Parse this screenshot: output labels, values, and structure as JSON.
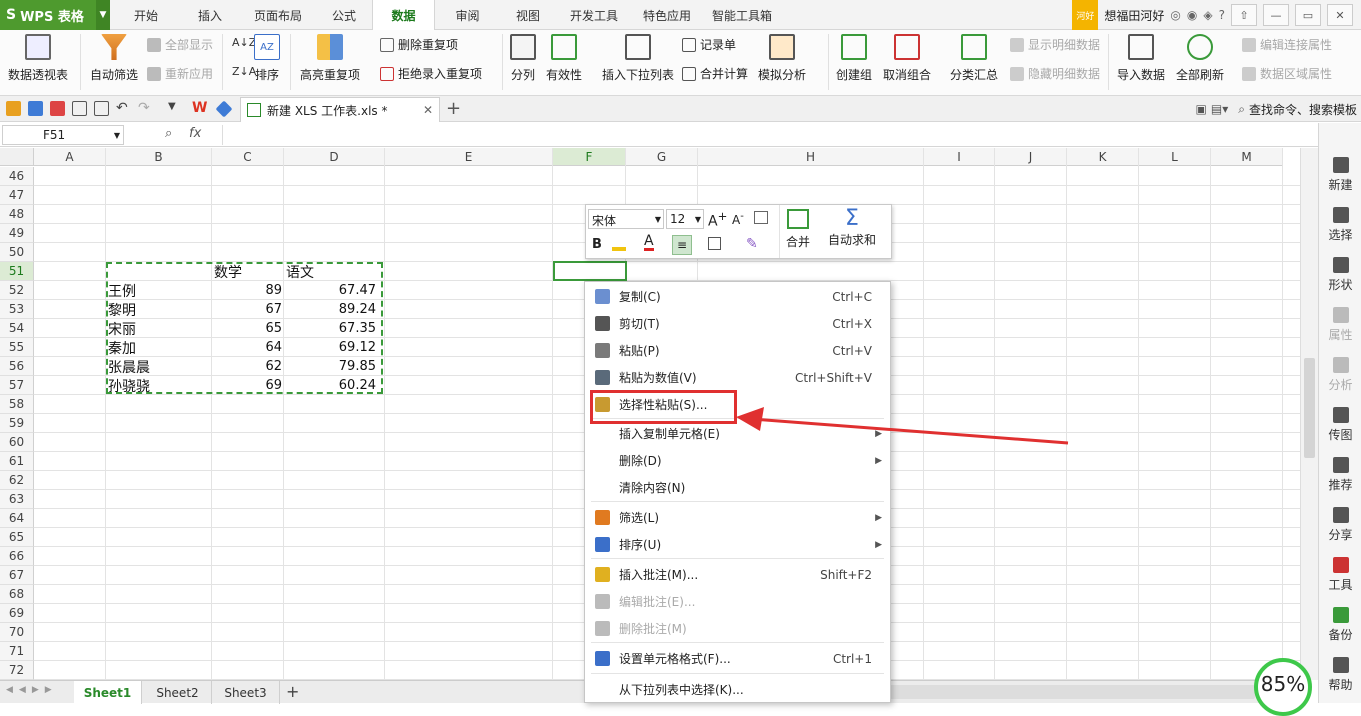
{
  "app": {
    "name": "WPS 表格"
  },
  "menu_tabs": [
    "开始",
    "插入",
    "页面布局",
    "公式",
    "数据",
    "审阅",
    "视图",
    "开发工具",
    "特色应用",
    "智能工具箱"
  ],
  "active_tab": "数据",
  "user": {
    "badge": "河好",
    "name": "想福田河好"
  },
  "ribbon": {
    "pivot": "数据透视表",
    "autofilter": "自动筛选",
    "show_all": "全部显示",
    "reapply": "重新应用",
    "sort": "排序",
    "highlight_dup": "高亮重复项",
    "remove_dup": "删除重复项",
    "reject_dup": "拒绝录入重复项",
    "split": "分列",
    "validity": "有效性",
    "insert_dropdown": "插入下拉列表",
    "record": "记录单",
    "consolidate": "合并计算",
    "whatif": "模拟分析",
    "group": "创建组",
    "ungroup": "取消组合",
    "subtotal": "分类汇总",
    "show_detail": "显示明细数据",
    "hide_detail": "隐藏明细数据",
    "import": "导入数据",
    "refresh_all": "全部刷新",
    "edit_links": "编辑连接属性",
    "range_props": "数据区域属性"
  },
  "doc_tab": {
    "title": "新建 XLS 工作表.xls *"
  },
  "search": {
    "label": "查找命令、搜索模板"
  },
  "formula": {
    "name_box": "F51",
    "fx": "fx"
  },
  "columns": [
    "A",
    "B",
    "C",
    "D",
    "E",
    "F",
    "G",
    "H",
    "I",
    "J",
    "K",
    "L",
    "M"
  ],
  "rows": [
    "46",
    "47",
    "48",
    "49",
    "50",
    "51",
    "52",
    "53",
    "54",
    "55",
    "56",
    "57",
    "58",
    "59",
    "60",
    "61",
    "62",
    "63",
    "64",
    "65",
    "66",
    "67",
    "68",
    "69",
    "70",
    "71",
    "72"
  ],
  "table": {
    "headers": [
      "数学",
      "语文"
    ],
    "data": [
      [
        "王例",
        "89",
        "67.47"
      ],
      [
        "黎明",
        "67",
        "89.24"
      ],
      [
        "宋丽",
        "65",
        "67.35"
      ],
      [
        "秦加",
        "64",
        "69.12"
      ],
      [
        "张晨晨",
        "62",
        "79.85"
      ],
      [
        "孙骁骁",
        "69",
        "60.24"
      ]
    ]
  },
  "mini_toolbar": {
    "font": "宋体",
    "size": "12",
    "bold": "B",
    "merge": "合并",
    "autosum": "自动求和"
  },
  "context_menu": [
    {
      "label": "复制(C)",
      "shortcut": "Ctrl+C",
      "icon": "copy-icon"
    },
    {
      "label": "剪切(T)",
      "shortcut": "Ctrl+X",
      "icon": "cut-icon"
    },
    {
      "label": "粘贴(P)",
      "shortcut": "Ctrl+V",
      "icon": "paste-icon"
    },
    {
      "label": "粘贴为数值(V)",
      "shortcut": "Ctrl+Shift+V",
      "icon": "paste-values-icon"
    },
    {
      "label": "选择性粘贴(S)...",
      "shortcut": "",
      "icon": "paste-special-icon"
    },
    {
      "label": "插入复制单元格(E)",
      "shortcut": "",
      "icon": ""
    },
    {
      "label": "删除(D)",
      "shortcut": "",
      "icon": ""
    },
    {
      "label": "清除内容(N)",
      "shortcut": "",
      "icon": ""
    },
    {
      "label": "筛选(L)",
      "shortcut": "",
      "icon": "filter-icon"
    },
    {
      "label": "排序(U)",
      "shortcut": "",
      "icon": "sort-icon"
    },
    {
      "label": "插入批注(M)...",
      "shortcut": "Shift+F2",
      "icon": "insert-comment-icon"
    },
    {
      "label": "编辑批注(E)...",
      "shortcut": "",
      "icon": "edit-comment-icon"
    },
    {
      "label": "删除批注(M)",
      "shortcut": "",
      "icon": "delete-comment-icon"
    },
    {
      "label": "设置单元格格式(F)...",
      "shortcut": "Ctrl+1",
      "icon": "format-cells-icon"
    },
    {
      "label": "从下拉列表中选择(K)...",
      "shortcut": "",
      "icon": ""
    }
  ],
  "sheets": [
    "Sheet1",
    "Sheet2",
    "Sheet3"
  ],
  "right_panel": [
    "新建",
    "选择",
    "形状",
    "属性",
    "分析",
    "传图",
    "推荐",
    "分享",
    "工具",
    "备份",
    "帮助"
  ],
  "zoom": {
    "value": "85%"
  },
  "colors": {
    "accent": "#4e9a2e",
    "highlight": "#e03030"
  }
}
